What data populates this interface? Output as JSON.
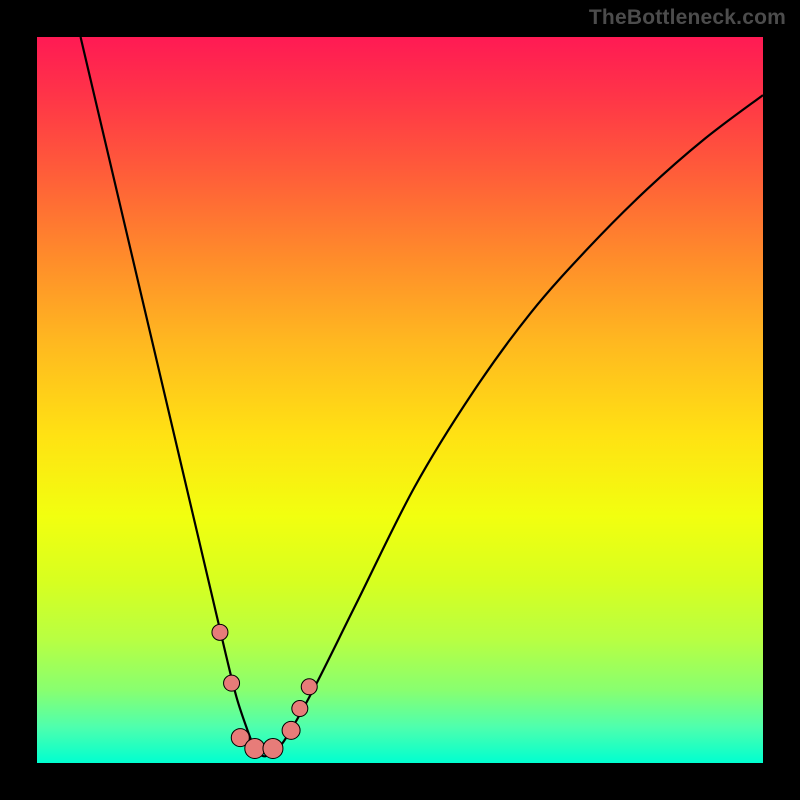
{
  "watermark": "TheBottleneck.com",
  "chart_data": {
    "type": "line",
    "title": "",
    "xlabel": "",
    "ylabel": "",
    "xlim": [
      0,
      100
    ],
    "ylim": [
      0,
      100
    ],
    "series": [
      {
        "name": "curve",
        "x": [
          6,
          10,
          14,
          18,
          22,
          24,
          26,
          27.5,
          29,
          30,
          31,
          32,
          34,
          38,
          44,
          52,
          60,
          68,
          76,
          84,
          92,
          100
        ],
        "y": [
          100,
          83,
          66,
          49,
          32,
          23.5,
          15,
          9,
          4.5,
          2,
          1,
          1.2,
          3,
          10,
          22,
          38,
          51,
          62,
          71,
          79,
          86,
          92
        ]
      }
    ],
    "markers": [
      {
        "x": 25.2,
        "y": 18,
        "r": 8
      },
      {
        "x": 26.8,
        "y": 11,
        "r": 8
      },
      {
        "x": 28.0,
        "y": 3.5,
        "r": 9
      },
      {
        "x": 30.0,
        "y": 2.0,
        "r": 10
      },
      {
        "x": 32.5,
        "y": 2.0,
        "r": 10
      },
      {
        "x": 35.0,
        "y": 4.5,
        "r": 9
      },
      {
        "x": 36.2,
        "y": 7.5,
        "r": 8
      },
      {
        "x": 37.5,
        "y": 10.5,
        "r": 8
      }
    ]
  }
}
